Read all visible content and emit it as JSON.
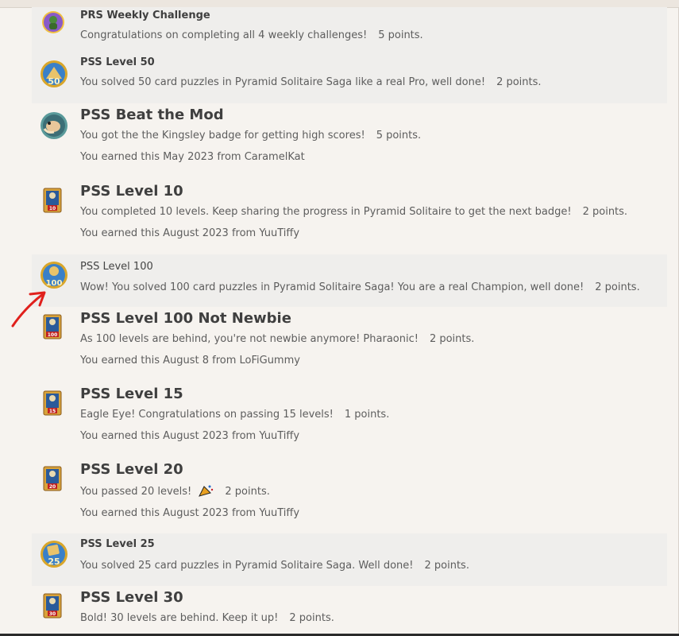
{
  "achievements": [
    {
      "title": "PRS Weekly Challenge",
      "description": "Congratulations on completing all 4 weekly challenges!",
      "points": "5 points.",
      "earned": "",
      "badge": "purple-hero-badge",
      "badge_number": ""
    },
    {
      "title": "PSS Level 50",
      "description": "You solved 50 card puzzles in Pyramid Solitaire Saga like a real Pro, well done!",
      "points": "2 points.",
      "earned": "",
      "badge": "pyramid-coin-badge",
      "badge_number": "50"
    },
    {
      "title": "PSS Beat the Mod",
      "description": "You got the the Kingsley badge for getting high scores!",
      "points": "5 points.",
      "earned": "You earned this May 2023 from CaramelKat",
      "badge": "kingsley-badge",
      "badge_number": ""
    },
    {
      "title": "PSS Level 10",
      "description": "You completed 10 levels. Keep sharing the progress in Pyramid Solitaire to get the next badge!",
      "points": "2 points.",
      "earned": "You earned this August 2023 from YuuTiffy",
      "badge": "pharaoh-card-badge",
      "badge_number": "10"
    },
    {
      "title": "PSS Level 100",
      "description": "Wow! You solved 100 card puzzles in Pyramid Solitaire Saga! You are a real Champion, well done!",
      "points": "2 points.",
      "earned": "",
      "badge": "pyramid-coin-badge",
      "badge_number": "100"
    },
    {
      "title": "PSS Level 100 Not Newbie",
      "description": "As 100 levels are behind, you're not newbie anymore! Pharaonic!",
      "points": "2 points.",
      "earned": "You earned this August 8 from LoFiGummy",
      "badge": "pharaoh-card-badge",
      "badge_number": "100"
    },
    {
      "title": "PSS Level 15",
      "description": "Eagle Eye! Congratulations on passing 15 levels!",
      "points": "1 points.",
      "earned": "You earned this August 2023 from YuuTiffy",
      "badge": "pharaoh-card-badge",
      "badge_number": "15"
    },
    {
      "title": "PSS Level 20",
      "description": "You passed 20 levels!",
      "points": "2 points.",
      "earned": "You earned this August 2023 from YuuTiffy",
      "badge": "pharaoh-card-badge",
      "badge_number": "20"
    },
    {
      "title": "PSS Level 25",
      "description": "You solved 25 card puzzles in Pyramid Solitaire Saga. Well done!",
      "points": "2 points.",
      "earned": "",
      "badge": "pyramid-coin-badge",
      "badge_number": "25"
    },
    {
      "title": "PSS Level 30",
      "description": "Bold! 30 levels are behind. Keep it up!",
      "points": "2 points.",
      "earned": "",
      "badge": "pharaoh-card-badge",
      "badge_number": "30"
    }
  ],
  "colors": {
    "shaded_row": "#efeeec",
    "background": "#f6f3ef",
    "annotation_arrow": "#e0201c"
  },
  "annotation": {
    "icon": "red-arrow-icon"
  }
}
